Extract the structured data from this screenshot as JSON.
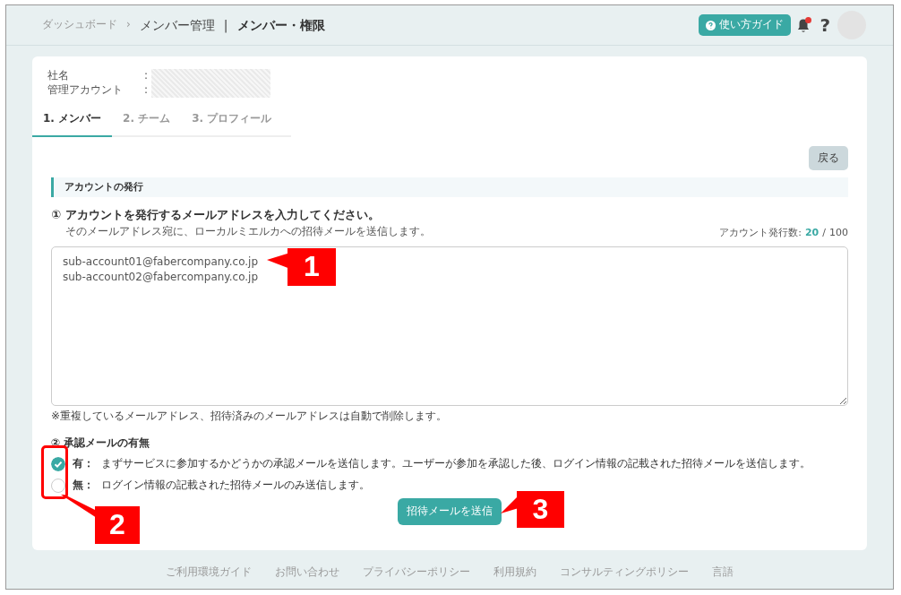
{
  "breadcrumb": [
    {
      "label": "ダッシュボード",
      "kind": "link",
      "separator": "›"
    },
    {
      "label": "メンバー管理",
      "kind": "parent",
      "separator": "|"
    },
    {
      "label": "メンバー・権限",
      "kind": "current"
    }
  ],
  "header": {
    "guide_button": "使い方ガイド",
    "notifications_unread": true,
    "help": "?"
  },
  "company_info": [
    {
      "label": "社名",
      "separator": ":"
    },
    {
      "label": "管理アカウント",
      "separator": ":"
    }
  ],
  "tabs": [
    {
      "label": "1. メンバー",
      "selected": true
    },
    {
      "label": "2. チーム",
      "selected": false
    },
    {
      "label": "3. プロフィール",
      "selected": false
    }
  ],
  "back_button": "戻る",
  "section_title": "アカウントの発行",
  "step1": {
    "title": "① アカウントを発行するメールアドレスを入力してください。",
    "description": "そのメールアドレス宛に、ローカルミエルカへの招待メールを送信します。",
    "counter": {
      "label": "アカウント発行数:",
      "used": "20",
      "separator": "/",
      "total": "100"
    },
    "emails": "sub-account01@fabercompany.co.jp\nsub-account02@fabercompany.co.jp",
    "note": "※重複しているメールアドレス、招待済みのメールアドレスは自動で削除します。"
  },
  "step2": {
    "title": "② 承認メールの有無",
    "options": [
      {
        "label": "有：",
        "description": "まずサービスに参加するかどうかの承認メールを送信します。ユーザーが参加を承認した後、ログイン情報の記載された招待メールを送信します。",
        "selected": true
      },
      {
        "label": "無：",
        "description": "ログイン情報の記載された招待メールのみ送信します。",
        "selected": false
      }
    ]
  },
  "submit_button": "招待メールを送信",
  "footer_links": [
    "ご利用環境ガイド",
    "お問い合わせ",
    "プライバシーポリシー",
    "利用規約",
    "コンサルティングポリシー",
    "言語"
  ],
  "callouts": [
    {
      "number": "1"
    },
    {
      "number": "2"
    },
    {
      "number": "3"
    }
  ]
}
